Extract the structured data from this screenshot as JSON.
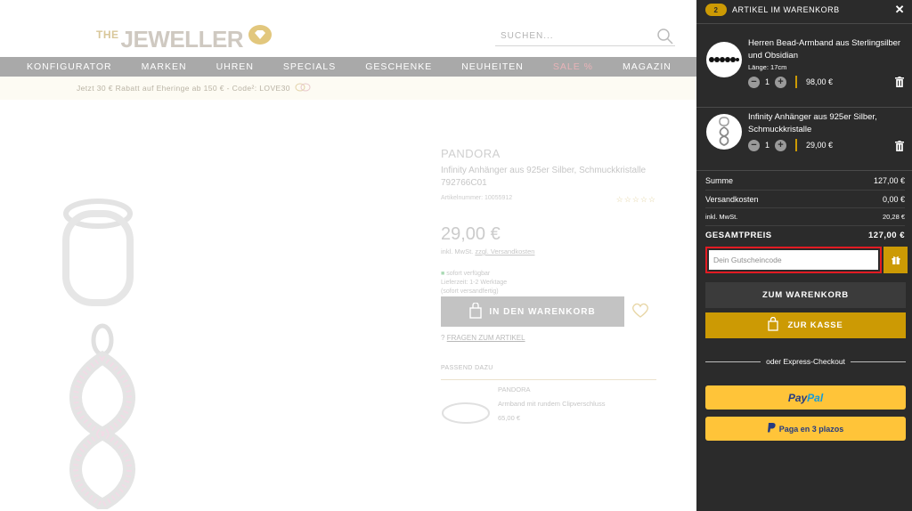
{
  "header": {
    "logo_prefix": "THE",
    "logo_text": "JEWELLER",
    "search_placeholder": "SUCHEN..."
  },
  "nav": [
    "KONFIGURATOR",
    "MARKEN",
    "UHREN",
    "SPECIALS",
    "GESCHENKE",
    "NEUHEITEN",
    "SALE %",
    "MAGAZIN"
  ],
  "promo": "Jetzt 30 € Rabatt auf Eheringe ab 150 € - Code²: LOVE30",
  "product": {
    "brand": "PANDORA",
    "name": "Infinity Anhänger aus 925er Silber, Schmuckkristalle",
    "sku": "792766C01",
    "article_number": "Artikelnummer: 10055912",
    "price": "29,00 €",
    "tax_prefix": "inkl. MwSt.",
    "tax_link": "zzgl. Versandkosten",
    "availability": "sofort verfügbar",
    "delivery": "Lieferzeit: 1-2 Werktage",
    "shipping_note": "(sofort versandfertig)",
    "add_to_cart": "IN DEN WARENKORB",
    "question_link": "FRAGEN ZUM ARTIKEL",
    "matching_heading": "PASSEND DAZU",
    "related": {
      "brand": "PANDORA",
      "name": "Armband mit rundem Clipverschluss",
      "price": "65,00 €"
    }
  },
  "cart": {
    "count": "2",
    "title": "ARTIKEL IM WARENKORB",
    "items": [
      {
        "name": "Herren Bead-Armband aus Sterlingsilber und Obsidian",
        "length": "Länge: 17cm",
        "qty": "1",
        "price": "98,00 €"
      },
      {
        "name": "Infinity Anhänger aus 925er Silber, Schmuckkristalle",
        "qty": "1",
        "price": "29,00 €"
      }
    ],
    "totals": {
      "sum_label": "Summe",
      "sum_value": "127,00 €",
      "shipping_label": "Versandkosten",
      "shipping_value": "0,00 €",
      "tax_label": "inkl. MwSt.",
      "tax_value": "20,28 €",
      "grand_label": "GESAMTPREIS",
      "grand_value": "127,00 €"
    },
    "coupon_placeholder": "Dein Gutscheincode",
    "to_cart_button": "ZUM WARENKORB",
    "checkout_button": "ZUR KASSE",
    "express_label": "oder Express-Checkout",
    "paypal_pay": "Pay",
    "paypal_pal": "Pal",
    "plazos_label": "Paga en 3 plazos"
  },
  "colors": {
    "accent": "#cc9a04",
    "cart_bg": "#2b2b2b",
    "paypal": "#ffc439",
    "coupon_highlight": "#e31b23"
  }
}
